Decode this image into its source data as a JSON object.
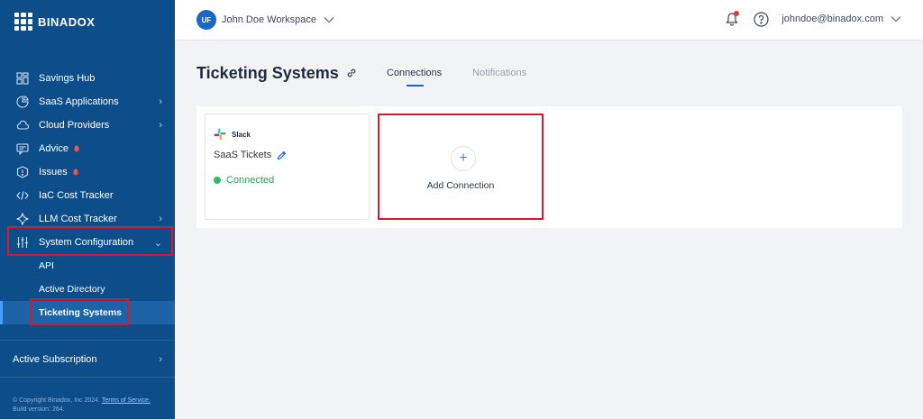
{
  "brand": {
    "name": "BINADOX"
  },
  "sidebar": {
    "items": [
      {
        "label": "Savings Hub",
        "icon": "dashboard-icon",
        "chevron": false,
        "alert": false
      },
      {
        "label": "SaaS Applications",
        "icon": "pie-chart-icon",
        "chevron": true,
        "alert": false
      },
      {
        "label": "Cloud Providers",
        "icon": "cloud-icon",
        "chevron": true,
        "alert": false
      },
      {
        "label": "Advice",
        "icon": "message-icon",
        "chevron": false,
        "alert": true
      },
      {
        "label": "Issues",
        "icon": "shield-icon",
        "chevron": false,
        "alert": true
      },
      {
        "label": "IaC Cost Tracker",
        "icon": "code-icon",
        "chevron": false,
        "alert": false
      },
      {
        "label": "LLM Cost Tracker",
        "icon": "sparkle-icon",
        "chevron": true,
        "alert": false
      },
      {
        "label": "System Configuration",
        "icon": "sliders-icon",
        "chevron": true,
        "alert": false
      }
    ],
    "subitems": [
      {
        "label": "API"
      },
      {
        "label": "Active Directory"
      },
      {
        "label": "Ticketing Systems"
      }
    ],
    "subscription": "Active Subscription",
    "footer": {
      "copyright": "© Copyright Binadox, Inc 2024.",
      "terms": "Terms of Service.",
      "build": "Build version: 264."
    }
  },
  "topbar": {
    "avatar_initials": "UF",
    "workspace": "John Doe Workspace",
    "user_email": "johndoe@binadox.com"
  },
  "page": {
    "title": "Ticketing Systems",
    "tabs": [
      {
        "label": "Connections"
      },
      {
        "label": "Notifications"
      }
    ]
  },
  "connections": [
    {
      "brand": "Slack",
      "name": "SaaS Tickets",
      "status": "Connected"
    }
  ],
  "add_connection": {
    "label": "Add Connection"
  },
  "colors": {
    "sidebar_bg": "#0d4d8a",
    "accent": "#1b66c9",
    "highlight": "#d7192b",
    "status_connected": "#2fb866",
    "alert": "#e23a3a"
  }
}
